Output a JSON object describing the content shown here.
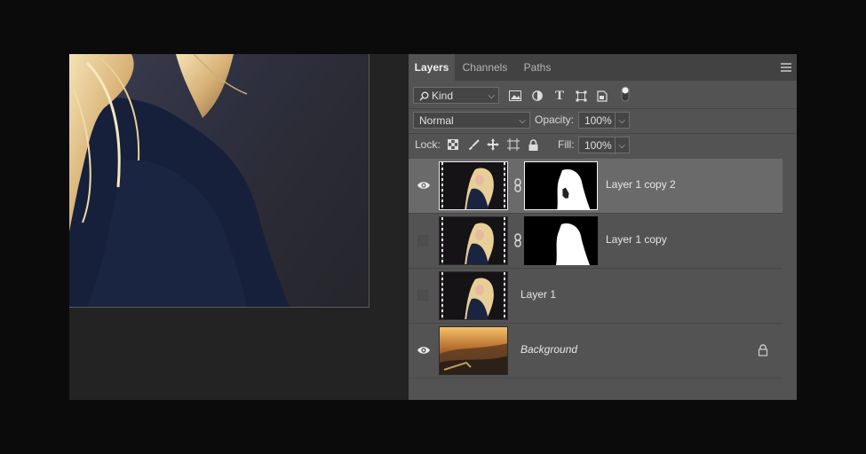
{
  "canvas": {
    "description_icon": "photo-canvas"
  },
  "panel": {
    "tabs": [
      {
        "label": "Layers",
        "active": true
      },
      {
        "label": "Channels",
        "active": false
      },
      {
        "label": "Paths",
        "active": false
      }
    ],
    "menu_icon": "hamburger-icon"
  },
  "filter": {
    "kind_label": "Kind",
    "icons": [
      "image-filter-icon",
      "adjustment-filter-icon",
      "type-filter-icon",
      "shape-filter-icon",
      "smart-object-filter-icon",
      "filter-toggle-icon"
    ]
  },
  "blend": {
    "mode": "Normal",
    "opacity_label": "Opacity:",
    "opacity_value": "100%"
  },
  "lock": {
    "label": "Lock:",
    "icons": [
      "lock-transparent-icon",
      "lock-image-icon",
      "lock-position-icon",
      "lock-artboard-icon",
      "lock-all-icon"
    ],
    "fill_label": "Fill:",
    "fill_value": "100%"
  },
  "layers": [
    {
      "name": "Layer 1 copy 2",
      "visible": true,
      "selected": true,
      "has_mask": true
    },
    {
      "name": "Layer 1 copy",
      "visible": false,
      "selected": false,
      "has_mask": true
    },
    {
      "name": "Layer 1",
      "visible": false,
      "selected": false,
      "has_mask": false
    },
    {
      "name": "Background",
      "visible": true,
      "selected": false,
      "has_mask": false,
      "locked": true
    }
  ],
  "colors": {
    "panel_bg": "#535353",
    "selected_row": "#6a6a6a",
    "tab_bar": "#424242"
  }
}
